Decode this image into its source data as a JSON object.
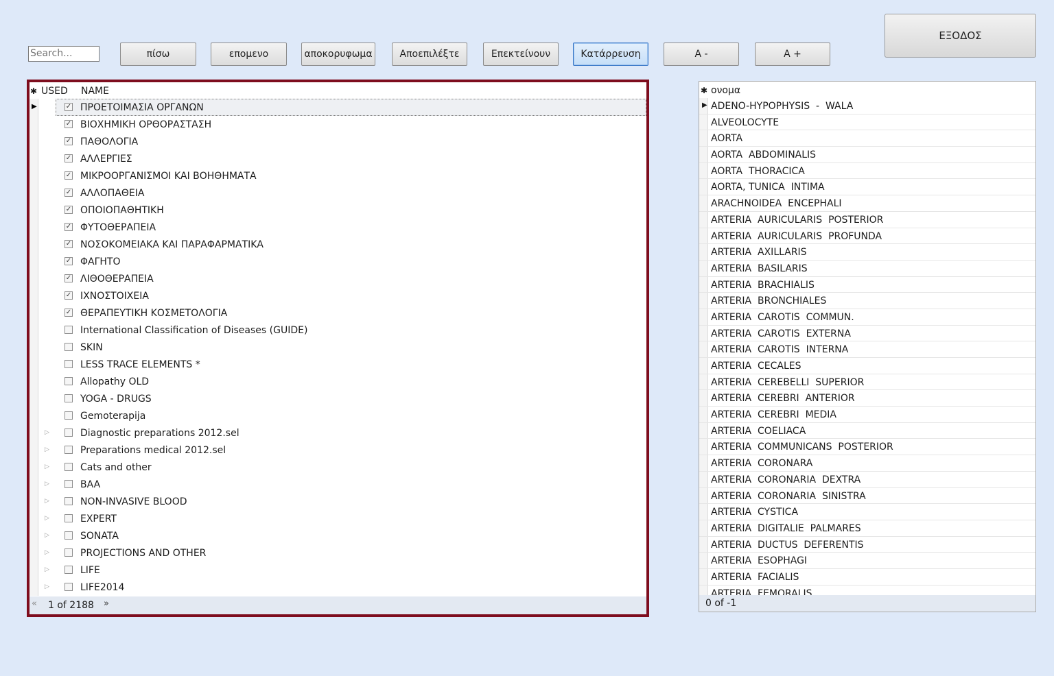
{
  "search": {
    "placeholder": "Search..."
  },
  "toolbar": {
    "back": "πίσω",
    "next": "επομενο",
    "hide": "αποκορυφωμα",
    "deselect": "Αποεπιλέξτε",
    "expand": "Επεκτείνουν",
    "collapse": "Κατάρρευση",
    "font_smaller": "A -",
    "font_larger": "A +",
    "exit": "ΕΞΟΔΟΣ"
  },
  "left_grid": {
    "header_marker": "✱",
    "col_used": "USED",
    "col_name": "NAME",
    "rows": [
      {
        "name": "ΠΡΟΕΤΟΙΜΑΣΙΑ ΟΡΓΑΝΩΝ",
        "checked": true,
        "expandable": false,
        "current": true
      },
      {
        "name": "ΒΙΟΧΗΜΙΚΗ ΟΡΘΟΡΑΣΤΑΣΗ",
        "checked": true,
        "expandable": false
      },
      {
        "name": "ΠΑΘΟΛΟΓΙΑ",
        "checked": true,
        "expandable": false
      },
      {
        "name": "ΑΛΛΕΡΓΙΕΣ",
        "checked": true,
        "expandable": false
      },
      {
        "name": "ΜΙΚΡΟΟΡΓΑΝΙΣΜΟΙ ΚΑΙ ΒΟΗΘΗΜΑΤΑ",
        "checked": true,
        "expandable": false
      },
      {
        "name": "ΑΛΛΟΠΑΘΕΙΑ",
        "checked": true,
        "expandable": false
      },
      {
        "name": "ΟΠΟΙΟΠΑΘΗΤΙΚΗ",
        "checked": true,
        "expandable": false
      },
      {
        "name": "ΦΥΤΟΘΕΡΑΠΕΙΑ",
        "checked": true,
        "expandable": false
      },
      {
        "name": "ΝΟΣΟΚΟΜΕΙΑΚΑ ΚΑΙ ΠΑΡΑΦΑΡΜΑΤΙΚΑ",
        "checked": true,
        "expandable": false
      },
      {
        "name": "ΦΑΓΗΤΟ",
        "checked": true,
        "expandable": false
      },
      {
        "name": "ΛΙΘΟΘΕΡΑΠΕΙΑ",
        "checked": true,
        "expandable": false
      },
      {
        "name": "ΙΧΝΟΣΤΟΙΧΕΙΑ",
        "checked": true,
        "expandable": false
      },
      {
        "name": "ΘΕΡΑΠΕΥΤΙΚΗ ΚΟΣΜΕΤΟΛΟΓΙΑ",
        "checked": true,
        "expandable": false
      },
      {
        "name": "International Classification of Diseases (GUIDE)",
        "checked": false,
        "expandable": false
      },
      {
        "name": "SKIN",
        "checked": false,
        "expandable": false
      },
      {
        "name": "LESS TRACE ELEMENTS *",
        "checked": false,
        "expandable": false
      },
      {
        "name": "Allopathy OLD",
        "checked": false,
        "expandable": false
      },
      {
        "name": "YOGA - DRUGS",
        "checked": false,
        "expandable": false
      },
      {
        "name": "Gemoterapija",
        "checked": false,
        "expandable": false
      },
      {
        "name": "Diagnostic preparations 2012.sel",
        "checked": false,
        "expandable": true
      },
      {
        "name": "Preparations medical 2012.sel",
        "checked": false,
        "expandable": true
      },
      {
        "name": "Cats and other",
        "checked": false,
        "expandable": true
      },
      {
        "name": "BAA",
        "checked": false,
        "expandable": true
      },
      {
        "name": "NON-INVASIVE BLOOD",
        "checked": false,
        "expandable": true
      },
      {
        "name": "EXPERT",
        "checked": false,
        "expandable": true
      },
      {
        "name": "SONATA",
        "checked": false,
        "expandable": true
      },
      {
        "name": "PROJECTIONS AND OTHER",
        "checked": false,
        "expandable": true
      },
      {
        "name": "LIFE",
        "checked": false,
        "expandable": true
      },
      {
        "name": "LIFE2014",
        "checked": false,
        "expandable": true
      }
    ],
    "pager": {
      "first_icon": "«",
      "text": "1 of 2188",
      "last_icon": "»"
    }
  },
  "right_grid": {
    "header_marker": "✱",
    "col_name": "ονομα",
    "rows": [
      "ADENO-HYPOPHYSIS  -  WALA",
      "ALVEOLOCYTE",
      "AORTA",
      "AORTA  ABDOMINALIS",
      "AORTA  THORACICA",
      "AORTA, TUNICA  INTIMA",
      "ARACHNOIDEA  ENCEPHALI",
      "ARTERIA  AURICULARIS  POSTERIOR",
      "ARTERIA  AURICULARIS  PROFUNDA",
      "ARTERIA  AXILLARIS",
      "ARTERIA  BASILARIS",
      "ARTERIA  BRACHIALIS",
      "ARTERIA  BRONCHIALES",
      "ARTERIA  CAROTIS  COMMUN.",
      "ARTERIA  CAROTIS  EXTERNA",
      "ARTERIA  CAROTIS  INTERNA",
      "ARTERIA  CECALES",
      "ARTERIA  CEREBELLI  SUPERIOR",
      "ARTERIA  CEREBRI  ANTERIOR",
      "ARTERIA  CEREBRI  MEDIA",
      "ARTERIA  COELIACA",
      "ARTERIA  COMMUNICANS  POSTERIOR",
      "ARTERIA  CORONARA",
      "ARTERIA  CORONARIA  DEXTRA",
      "ARTERIA  CORONARIA  SINISTRA",
      "ARTERIA  CYSTICA",
      "ARTERIA  DIGITALIE  PALMARES",
      "ARTERIA  DUCTUS  DEFERENTIS",
      "ARTERIA  ESOPHAGI",
      "ARTERIA  FACIALIS",
      "ARTERIA  FEMORALIS"
    ],
    "pager": {
      "text": "0 of -1"
    }
  },
  "colors": {
    "panel_border": "#7e0d1e",
    "background": "#dee9f9",
    "footer": "#e3e9f2"
  }
}
